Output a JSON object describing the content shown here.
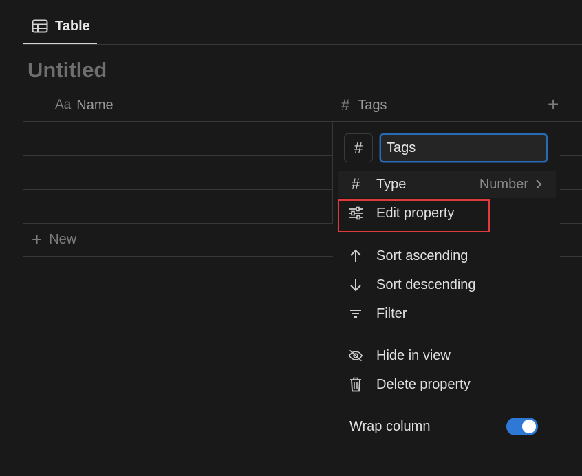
{
  "view_tab": {
    "label": "Table",
    "icon": "table-icon"
  },
  "page_title": "Untitled",
  "table": {
    "columns": [
      {
        "icon": "Aa",
        "label": "Name"
      },
      {
        "icon": "#",
        "label": "Tags"
      }
    ],
    "add_column_label": "+",
    "new_row_label": "New"
  },
  "property_menu": {
    "type_icon": "#",
    "name_value": "Tags",
    "type_item": {
      "label": "Type",
      "value": "Number",
      "icon": "hash-icon"
    },
    "edit_item": {
      "label": "Edit property",
      "icon": "sliders-icon"
    },
    "sort_asc": {
      "label": "Sort ascending",
      "icon": "arrow-up-icon"
    },
    "sort_desc": {
      "label": "Sort descending",
      "icon": "arrow-down-icon"
    },
    "filter": {
      "label": "Filter",
      "icon": "filter-icon"
    },
    "hide": {
      "label": "Hide in view",
      "icon": "eye-off-icon"
    },
    "delete": {
      "label": "Delete property",
      "icon": "trash-icon"
    },
    "wrap": {
      "label": "Wrap column",
      "enabled": true
    }
  },
  "colors": {
    "background": "#191919",
    "accent": "#2f79d6",
    "highlight": "#e03a3a"
  }
}
